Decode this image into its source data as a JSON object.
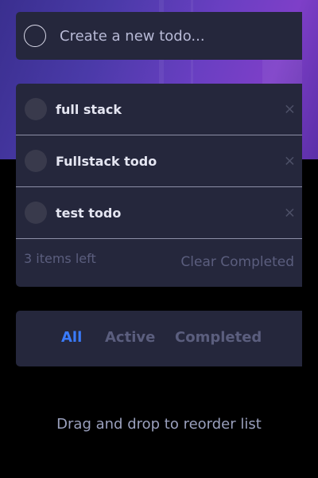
{
  "new_todo": {
    "placeholder": "Create a new todo..."
  },
  "todos": [
    {
      "text": "full stack",
      "completed": false
    },
    {
      "text": "Fullstack todo",
      "completed": false
    },
    {
      "text": "test todo",
      "completed": false
    }
  ],
  "footer": {
    "items_left": "3 items left",
    "clear_completed": "Clear Completed"
  },
  "filters": {
    "all": "All",
    "active": "Active",
    "completed": "Completed",
    "selected": "All"
  },
  "hint": "Drag and drop to reorder list",
  "icons": {
    "delete": "×"
  },
  "colors": {
    "card": "#25273c",
    "accent": "#3a7bfd",
    "muted": "#5b5e7e",
    "text": "#e4e5f1",
    "background": "#000000"
  }
}
